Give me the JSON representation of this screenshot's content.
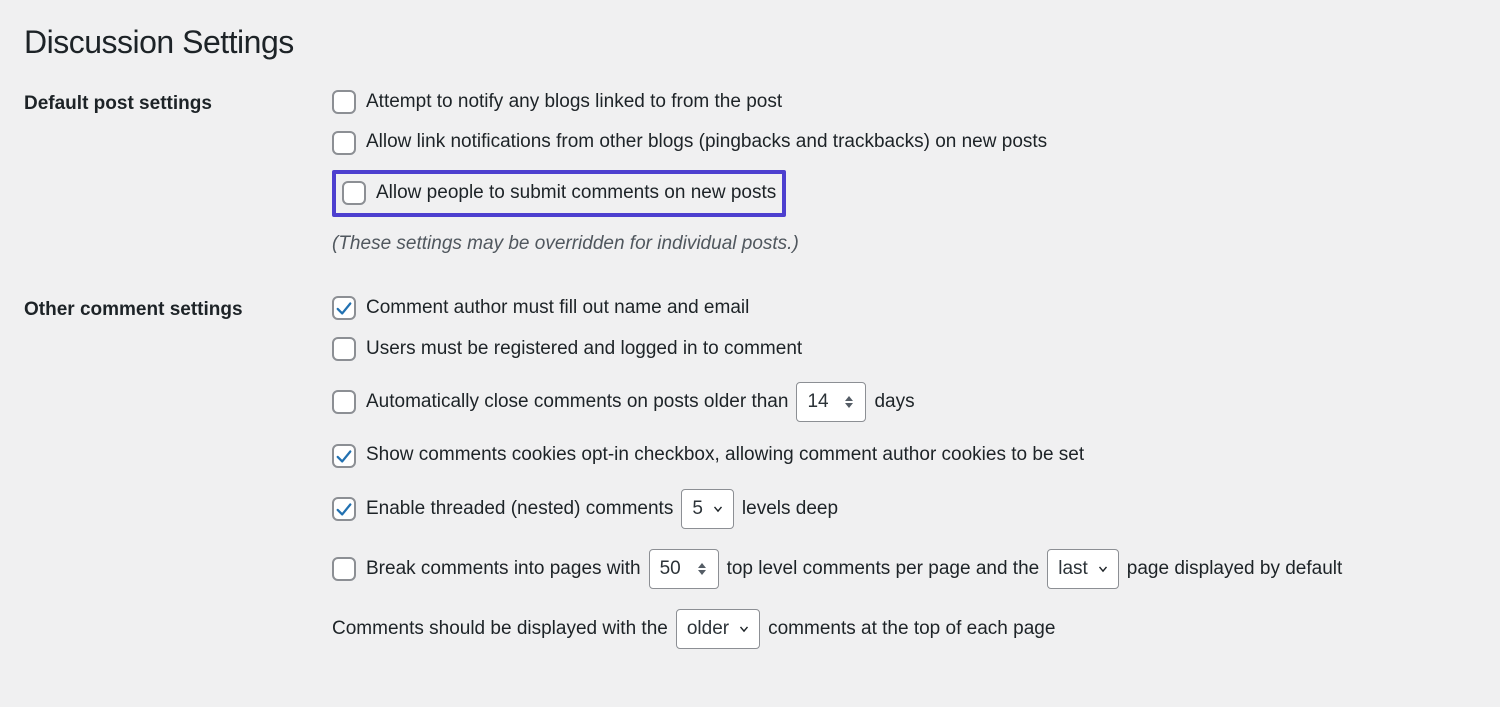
{
  "title": "Discussion Settings",
  "sections": {
    "default_post": {
      "label": "Default post settings",
      "opt_notify": "Attempt to notify any blogs linked to from the post",
      "opt_pingback": "Allow link notifications from other blogs (pingbacks and trackbacks) on new posts",
      "opt_comments": "Allow people to submit comments on new posts",
      "note": "(These settings may be overridden for individual posts.)"
    },
    "other_comment": {
      "label": "Other comment settings",
      "opt_name_email": "Comment author must fill out name and email",
      "opt_registered": "Users must be registered and logged in to comment",
      "autoclose_before": "Automatically close comments on posts older than",
      "autoclose_value": "14",
      "autoclose_after": "days",
      "opt_cookies": "Show comments cookies opt-in checkbox, allowing comment author cookies to be set",
      "threaded_before": "Enable threaded (nested) comments",
      "threaded_value": "5",
      "threaded_after": "levels deep",
      "paginate_before": "Break comments into pages with",
      "paginate_value": "50",
      "paginate_mid": "top level comments per page and the",
      "paginate_page_sel": "last",
      "paginate_after": "page displayed by default",
      "order_before": "Comments should be displayed with the",
      "order_sel": "older",
      "order_after": "comments at the top of each page"
    }
  },
  "checks": {
    "notify": false,
    "pingback": false,
    "comments_new": false,
    "name_email": true,
    "registered": false,
    "autoclose": false,
    "cookies": true,
    "threaded": true,
    "paginate": false
  }
}
